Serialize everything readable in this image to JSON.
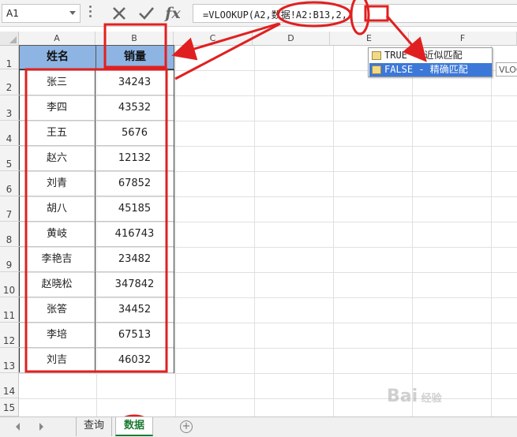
{
  "name_box": "A1",
  "formula_bar": {
    "fx_label": "fx",
    "formula": "=VLOOKUP(A2,数据!A2:B13,2,"
  },
  "columns": [
    "A",
    "B",
    "C",
    "D",
    "E",
    "F"
  ],
  "rows": [
    "1",
    "2",
    "3",
    "4",
    "5",
    "6",
    "7",
    "8",
    "9",
    "10",
    "11",
    "12",
    "13",
    "14",
    "15"
  ],
  "table": {
    "headers": [
      "姓名",
      "销量"
    ],
    "names": [
      "张三",
      "李四",
      "王五",
      "赵六",
      "刘青",
      "胡八",
      "黄岐",
      "李艳吉",
      "赵晓松",
      "张答",
      "李培",
      "刘吉"
    ],
    "sales": [
      "34243",
      "43532",
      "5676",
      "12132",
      "67852",
      "45185",
      "416743",
      "23482",
      "347842",
      "34452",
      "67513",
      "46032"
    ]
  },
  "autocomplete": {
    "items": [
      "TRUE - 近似匹配",
      "FALSE - 精确匹配"
    ],
    "selected_index": 1,
    "tooltip": "VLOOKUP"
  },
  "sheet_tabs": [
    "查询",
    "数据"
  ],
  "active_sheet": "数据",
  "watermark": "Bai 经验",
  "colors": {
    "header_fill": "#8eb4e3",
    "annotation_red": "#e02020",
    "active_tab": "#1d7a35",
    "selection_blue": "#3c78d8"
  }
}
